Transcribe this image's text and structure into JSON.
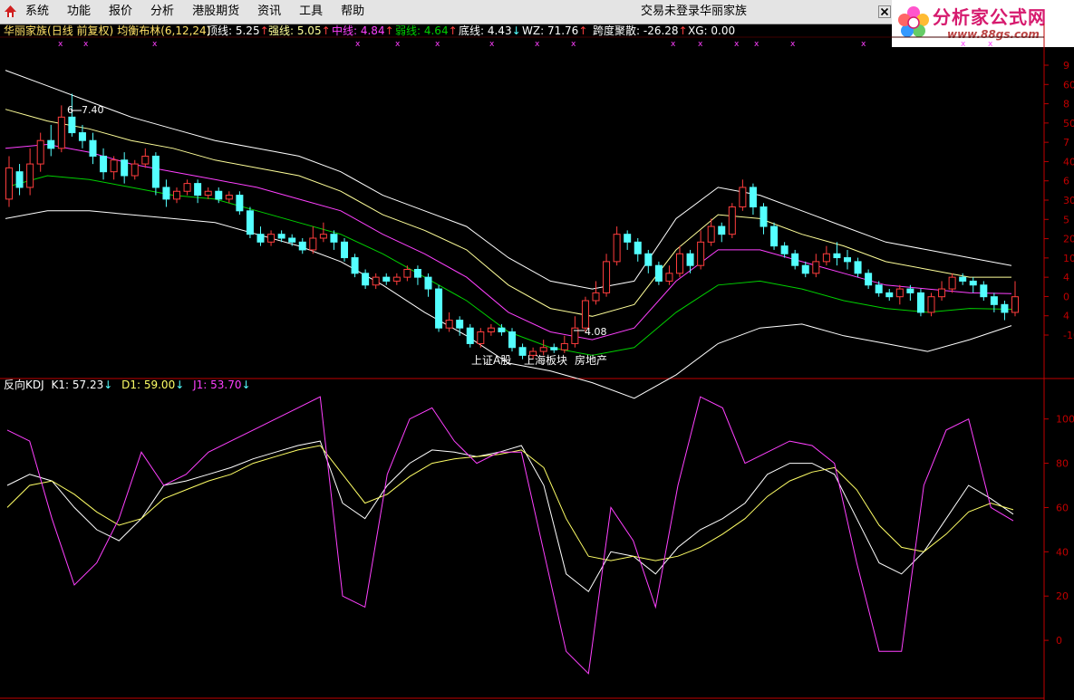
{
  "menu": {
    "items": [
      "系统",
      "功能",
      "报价",
      "分析",
      "港股期货",
      "资讯",
      "工具",
      "帮助"
    ]
  },
  "status": {
    "login": "交易未登录",
    "stock": "华丽家族"
  },
  "brand": {
    "name": "分析家公式网",
    "url": "www.88gs.com"
  },
  "colors": {
    "bg": "#000000",
    "up": "#ff3d3d",
    "down": "#54ffff",
    "top": "#ffffff",
    "strong": "#ffff99",
    "mid": "#ff40ff",
    "weak": "#00d000",
    "bottom": "#ffffff",
    "k": "#ffffff",
    "d": "#ffff66",
    "j": "#ff40ff",
    "frame": "#c00000",
    "brand": "#d61a6e"
  },
  "main_panel": {
    "stock": "华丽家族",
    "period": "(日线 前复权)",
    "indicator": "均衡布林(6,12,24)",
    "metrics": [
      {
        "label": "顶线: ",
        "value": "5.25",
        "arrow": "↑",
        "color": "#ffffff"
      },
      {
        "label": "强线: ",
        "value": "5.05",
        "arrow": "↑",
        "color": "#ffff99"
      },
      {
        "label": "中线: ",
        "value": "4.84",
        "arrow": "↑",
        "color": "#ff40ff"
      },
      {
        "label": "弱线: ",
        "value": "4.64",
        "arrow": "↑",
        "color": "#00d000"
      },
      {
        "label": "底线: ",
        "value": "4.43",
        "arrow": "↓",
        "color": "#ffffff"
      },
      {
        "label": "WZ: ",
        "value": "71.76",
        "arrow": "↑",
        "color": "#ffffff"
      },
      {
        "label": "跨度聚散: ",
        "value": "-26.28",
        "arrow": "↑",
        "color": "#ffffff"
      },
      {
        "label": "XG: ",
        "value": "0.00",
        "arrow": "",
        "color": "#ffffff"
      }
    ],
    "y_axis_ticks": [
      "9",
      "60",
      "8",
      "50",
      "7",
      "40",
      "6",
      "30",
      "5",
      "20",
      "10",
      "4",
      "0",
      "4",
      "-10"
    ],
    "high_label": "7.40",
    "low_label": "4.08",
    "tags": [
      "上证A股",
      "上海板块",
      "房地产"
    ]
  },
  "kdj_panel": {
    "title": "反向KDJ",
    "k_label": "K1: ",
    "k_value": "57.23",
    "k_arrow": "↓",
    "d_label": "D1: ",
    "d_value": "59.00",
    "d_arrow": "↓",
    "j_label": "J1: ",
    "j_value": "53.70",
    "j_arrow": "↓",
    "y_axis_ticks": [
      "100",
      "80",
      "60",
      "40",
      "20",
      "0"
    ]
  },
  "chart_data": {
    "type": "candlestick",
    "price_range": [
      3.95,
      7.95
    ],
    "kdj_range": [
      -20,
      115
    ],
    "high": 7.4,
    "low": 4.08,
    "candles": [
      [
        6.05,
        6.45,
        6.6,
        5.95
      ],
      [
        6.4,
        6.2,
        6.5,
        6.1
      ],
      [
        6.2,
        6.5,
        6.7,
        6.1
      ],
      [
        6.5,
        6.8,
        6.9,
        6.4
      ],
      [
        6.8,
        6.7,
        7.0,
        6.6
      ],
      [
        6.7,
        7.1,
        7.25,
        6.65
      ],
      [
        7.1,
        6.9,
        7.4,
        6.85
      ],
      [
        6.9,
        6.8,
        7.0,
        6.7
      ],
      [
        6.8,
        6.6,
        6.9,
        6.5
      ],
      [
        6.6,
        6.4,
        6.7,
        6.3
      ],
      [
        6.4,
        6.55,
        6.6,
        6.3
      ],
      [
        6.55,
        6.35,
        6.65,
        6.25
      ],
      [
        6.35,
        6.5,
        6.55,
        6.3
      ],
      [
        6.5,
        6.6,
        6.7,
        6.45
      ],
      [
        6.6,
        6.2,
        6.65,
        6.1
      ],
      [
        6.2,
        6.05,
        6.3,
        5.95
      ],
      [
        6.05,
        6.15,
        6.2,
        6.0
      ],
      [
        6.15,
        6.25,
        6.3,
        6.1
      ],
      [
        6.25,
        6.1,
        6.3,
        6.0
      ],
      [
        6.1,
        6.15,
        6.2,
        6.05
      ],
      [
        6.15,
        6.05,
        6.2,
        6.0
      ],
      [
        6.05,
        6.1,
        6.15,
        6.0
      ],
      [
        6.1,
        5.9,
        6.15,
        5.85
      ],
      [
        5.9,
        5.6,
        5.95,
        5.55
      ],
      [
        5.6,
        5.5,
        5.7,
        5.45
      ],
      [
        5.5,
        5.6,
        5.65,
        5.45
      ],
      [
        5.6,
        5.55,
        5.65,
        5.5
      ],
      [
        5.55,
        5.5,
        5.6,
        5.45
      ],
      [
        5.5,
        5.4,
        5.55,
        5.35
      ],
      [
        5.4,
        5.55,
        5.7,
        5.35
      ],
      [
        5.55,
        5.6,
        5.75,
        5.5
      ],
      [
        5.6,
        5.5,
        5.65,
        5.4
      ],
      [
        5.5,
        5.3,
        5.55,
        5.25
      ],
      [
        5.3,
        5.1,
        5.35,
        5.05
      ],
      [
        5.1,
        4.95,
        5.15,
        4.9
      ],
      [
        4.95,
        5.05,
        5.1,
        4.9
      ],
      [
        5.05,
        5.0,
        5.1,
        4.95
      ],
      [
        5.0,
        5.05,
        5.1,
        4.95
      ],
      [
        5.05,
        5.15,
        5.2,
        5.0
      ],
      [
        5.15,
        5.05,
        5.2,
        4.95
      ],
      [
        5.05,
        4.9,
        5.1,
        4.8
      ],
      [
        4.9,
        4.4,
        4.95,
        4.35
      ],
      [
        4.4,
        4.5,
        4.6,
        4.35
      ],
      [
        4.5,
        4.4,
        4.55,
        4.3
      ],
      [
        4.4,
        4.2,
        4.45,
        4.15
      ],
      [
        4.2,
        4.35,
        4.4,
        4.15
      ],
      [
        4.35,
        4.4,
        4.45,
        4.3
      ],
      [
        4.4,
        4.35,
        4.45,
        4.3
      ],
      [
        4.35,
        4.15,
        4.4,
        4.1
      ],
      [
        4.15,
        4.05,
        4.2,
        4.0
      ],
      [
        4.05,
        4.1,
        4.15,
        4.0
      ],
      [
        4.1,
        4.15,
        4.25,
        4.05
      ],
      [
        4.15,
        4.12,
        4.2,
        4.08
      ],
      [
        4.12,
        4.2,
        4.3,
        4.08
      ],
      [
        4.2,
        4.4,
        4.55,
        4.15
      ],
      [
        4.4,
        4.75,
        4.8,
        4.35
      ],
      [
        4.75,
        4.85,
        5.0,
        4.7
      ],
      [
        4.85,
        5.25,
        5.35,
        4.8
      ],
      [
        5.25,
        5.6,
        5.7,
        5.2
      ],
      [
        5.6,
        5.5,
        5.65,
        5.4
      ],
      [
        5.5,
        5.35,
        5.55,
        5.25
      ],
      [
        5.35,
        5.2,
        5.4,
        5.1
      ],
      [
        5.2,
        5.0,
        5.25,
        4.95
      ],
      [
        5.0,
        5.1,
        5.2,
        4.95
      ],
      [
        5.1,
        5.35,
        5.45,
        5.05
      ],
      [
        5.35,
        5.2,
        5.4,
        5.1
      ],
      [
        5.2,
        5.5,
        5.65,
        5.15
      ],
      [
        5.5,
        5.7,
        5.8,
        5.45
      ],
      [
        5.7,
        5.6,
        5.75,
        5.5
      ],
      [
        5.6,
        5.95,
        6.0,
        5.55
      ],
      [
        5.95,
        6.2,
        6.3,
        5.9
      ],
      [
        6.2,
        5.95,
        6.25,
        5.85
      ],
      [
        5.95,
        5.7,
        6.0,
        5.6
      ],
      [
        5.7,
        5.45,
        5.75,
        5.4
      ],
      [
        5.45,
        5.35,
        5.5,
        5.3
      ],
      [
        5.35,
        5.2,
        5.4,
        5.15
      ],
      [
        5.2,
        5.1,
        5.25,
        5.05
      ],
      [
        5.1,
        5.25,
        5.35,
        5.05
      ],
      [
        5.25,
        5.35,
        5.45,
        5.2
      ],
      [
        5.35,
        5.3,
        5.5,
        5.2
      ],
      [
        5.3,
        5.25,
        5.4,
        5.15
      ],
      [
        5.25,
        5.1,
        5.3,
        5.05
      ],
      [
        5.1,
        4.95,
        5.15,
        4.9
      ],
      [
        4.95,
        4.85,
        5.0,
        4.8
      ],
      [
        4.85,
        4.8,
        4.9,
        4.75
      ],
      [
        4.8,
        4.9,
        4.95,
        4.7
      ],
      [
        4.9,
        4.85,
        4.95,
        4.75
      ],
      [
        4.85,
        4.6,
        4.9,
        4.55
      ],
      [
        4.6,
        4.8,
        4.85,
        4.55
      ],
      [
        4.8,
        4.9,
        5.0,
        4.75
      ],
      [
        4.9,
        5.05,
        5.1,
        4.85
      ],
      [
        5.05,
        5.0,
        5.1,
        4.95
      ],
      [
        5.0,
        4.95,
        5.05,
        4.85
      ],
      [
        4.95,
        4.8,
        5.0,
        4.75
      ],
      [
        4.8,
        4.7,
        4.85,
        4.6
      ],
      [
        4.7,
        4.6,
        4.75,
        4.5
      ],
      [
        4.6,
        4.8,
        5.0,
        4.55
      ]
    ],
    "bands": {
      "top": [
        7.7,
        7.5,
        7.3,
        7.1,
        6.95,
        6.8,
        6.7,
        6.6,
        6.4,
        6.1,
        5.9,
        5.7,
        5.3,
        5.0,
        4.9,
        5.0,
        5.8,
        6.2,
        6.1,
        5.9,
        5.7,
        5.5,
        5.4,
        5.3,
        5.2
      ],
      "strong": [
        7.2,
        7.05,
        6.95,
        6.8,
        6.7,
        6.55,
        6.45,
        6.35,
        6.15,
        5.85,
        5.65,
        5.4,
        4.95,
        4.65,
        4.55,
        4.7,
        5.4,
        5.85,
        5.8,
        5.6,
        5.45,
        5.25,
        5.15,
        5.05,
        5.05
      ],
      "mid": [
        6.7,
        6.75,
        6.65,
        6.5,
        6.4,
        6.3,
        6.2,
        6.05,
        5.9,
        5.6,
        5.35,
        5.05,
        4.6,
        4.35,
        4.25,
        4.4,
        5.0,
        5.4,
        5.4,
        5.25,
        5.1,
        4.95,
        4.9,
        4.85,
        4.84
      ],
      "weak": [
        6.2,
        6.35,
        6.3,
        6.2,
        6.1,
        6.05,
        5.9,
        5.75,
        5.6,
        5.35,
        5.05,
        4.75,
        4.35,
        4.15,
        4.05,
        4.15,
        4.6,
        4.95,
        5.0,
        4.9,
        4.75,
        4.65,
        4.6,
        4.65,
        4.64
      ],
      "bottom": [
        5.8,
        5.9,
        5.9,
        5.85,
        5.8,
        5.75,
        5.6,
        5.45,
        5.25,
        4.95,
        4.6,
        4.3,
        3.95,
        3.85,
        3.7,
        3.5,
        3.8,
        4.2,
        4.4,
        4.45,
        4.3,
        4.2,
        4.1,
        4.25,
        4.43
      ]
    },
    "kdj": {
      "K": [
        70,
        75,
        72,
        60,
        50,
        45,
        55,
        70,
        72,
        75,
        78,
        82,
        85,
        88,
        90,
        62,
        55,
        70,
        80,
        86,
        85,
        83,
        85,
        88,
        70,
        30,
        22,
        40,
        38,
        30,
        42,
        50,
        55,
        62,
        75,
        80,
        80,
        75,
        55,
        35,
        30,
        40,
        55,
        70,
        64,
        57
      ],
      "D": [
        60,
        70,
        72,
        66,
        58,
        52,
        55,
        64,
        68,
        72,
        75,
        80,
        83,
        86,
        88,
        75,
        62,
        66,
        74,
        80,
        82,
        83,
        84,
        86,
        78,
        55,
        38,
        36,
        38,
        36,
        38,
        42,
        48,
        55,
        65,
        72,
        76,
        78,
        68,
        52,
        42,
        40,
        48,
        58,
        62,
        59
      ],
      "J": [
        95,
        90,
        55,
        25,
        35,
        55,
        85,
        70,
        75,
        85,
        90,
        95,
        100,
        105,
        110,
        20,
        15,
        75,
        100,
        105,
        90,
        80,
        85,
        85,
        40,
        -5,
        -15,
        60,
        45,
        15,
        70,
        110,
        105,
        80,
        85,
        90,
        88,
        80,
        35,
        -5,
        -5,
        70,
        95,
        100,
        60,
        54
      ]
    }
  }
}
